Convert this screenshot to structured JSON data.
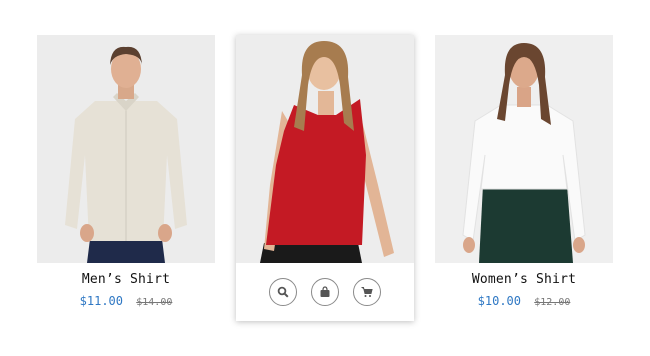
{
  "products": [
    {
      "title": "Men’s Shirt",
      "price": "$11.00",
      "old_price": "$14.00"
    },
    {
      "actions": [
        {
          "icon": "search-icon"
        },
        {
          "icon": "bag-icon"
        },
        {
          "icon": "cart-icon"
        }
      ]
    },
    {
      "title": "Women’s Shirt",
      "price": "$10.00",
      "old_price": "$12.00"
    }
  ],
  "colors": {
    "price": "#2f78c4",
    "old_price": "#777777",
    "photo_bg": "#eeeeee"
  }
}
